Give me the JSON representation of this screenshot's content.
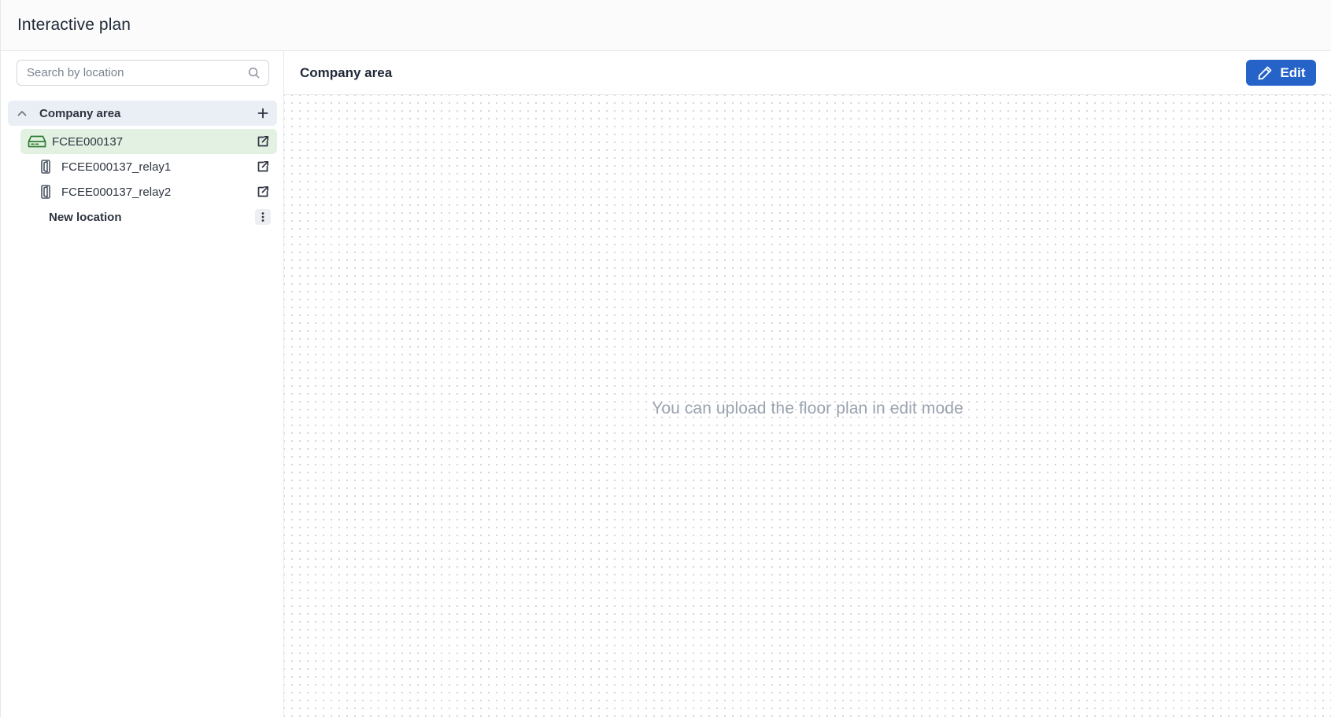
{
  "header": {
    "title": "Interactive plan"
  },
  "sidebar": {
    "search": {
      "placeholder": "Search by location",
      "icon": "search-icon"
    },
    "tree": {
      "root": {
        "label": "Company area",
        "expanded": true,
        "action_icon": "plus-icon"
      },
      "device": {
        "label": "FCEE000137",
        "icon": "hub-device-icon",
        "action_icon": "external-link-icon",
        "selected": true
      },
      "relays": [
        {
          "label": "FCEE000137_relay1",
          "icon": "relay-icon",
          "action_icon": "external-link-icon"
        },
        {
          "label": "FCEE000137_relay2",
          "icon": "relay-icon",
          "action_icon": "external-link-icon"
        }
      ],
      "location": {
        "label": "New location",
        "action_icon": "more-vertical-icon"
      }
    }
  },
  "main": {
    "title": "Company area",
    "edit_label": "Edit",
    "empty_message": "You can upload the floor plan in edit mode"
  },
  "colors": {
    "primary": "#2563c9",
    "selected_row": "#e3f1e3",
    "root_row": "#eaeef5",
    "device_icon": "#2e7d32",
    "muted_text": "#9aa3b0"
  }
}
